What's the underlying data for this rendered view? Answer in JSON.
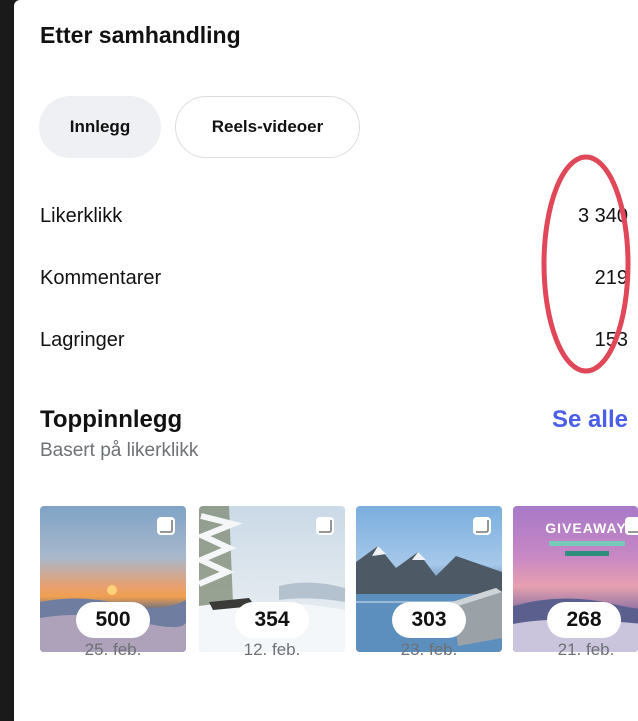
{
  "section": {
    "title": "Etter samhandling"
  },
  "tabs": [
    {
      "label": "Innlegg",
      "active": true
    },
    {
      "label": "Reels-videoer",
      "active": false
    }
  ],
  "metrics": [
    {
      "label": "Likerklikk",
      "value": "3 340"
    },
    {
      "label": "Kommentarer",
      "value": "219"
    },
    {
      "label": "Lagringer",
      "value": "153"
    }
  ],
  "top_posts": {
    "title": "Toppinnlegg",
    "subtitle": "Basert på likerklikk",
    "see_all": "Se alle",
    "posts": [
      {
        "count": "500",
        "date": "25. feb."
      },
      {
        "count": "354",
        "date": "12. feb."
      },
      {
        "count": "303",
        "date": "23. feb."
      },
      {
        "count": "268",
        "date": "21. feb.",
        "overlay_text": "GIVEAWAY"
      }
    ]
  },
  "colors": {
    "accent": "#4a5ee8",
    "annotation": "#e0485a",
    "background": "#ffffff",
    "frame": "#1a1a1a"
  },
  "icons": [
    "carousel-icon"
  ]
}
